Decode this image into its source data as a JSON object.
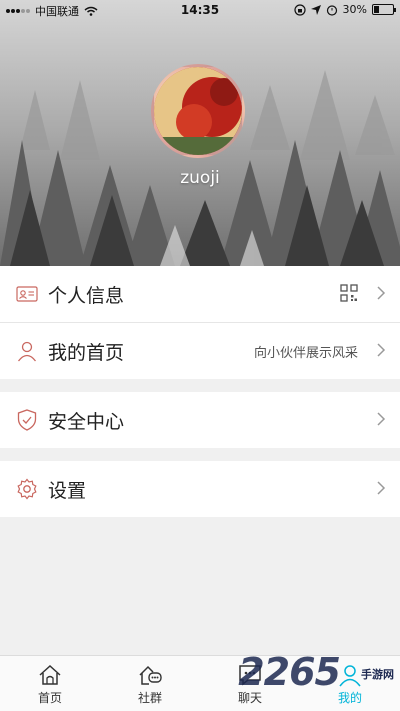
{
  "status_bar": {
    "carrier": "中国联通",
    "time": "14:35",
    "battery": "30%",
    "battery_level": 0.3
  },
  "profile": {
    "username": "zuoji"
  },
  "menu": {
    "personal_info": "个人信息",
    "my_homepage": "我的首页",
    "my_homepage_sub": "向小伙伴展示风采",
    "security_center": "安全中心",
    "settings": "设置"
  },
  "tabs": [
    {
      "label": "首页",
      "icon": "home-icon"
    },
    {
      "label": "社群",
      "icon": "community-icon"
    },
    {
      "label": "聊天",
      "icon": "chat-icon"
    },
    {
      "label": "我的",
      "icon": "user-icon"
    }
  ],
  "watermark": {
    "number": "2265",
    "suffix": "手游网"
  },
  "colors": {
    "accent": "#00b4d8",
    "icon_red": "#c9675f"
  }
}
